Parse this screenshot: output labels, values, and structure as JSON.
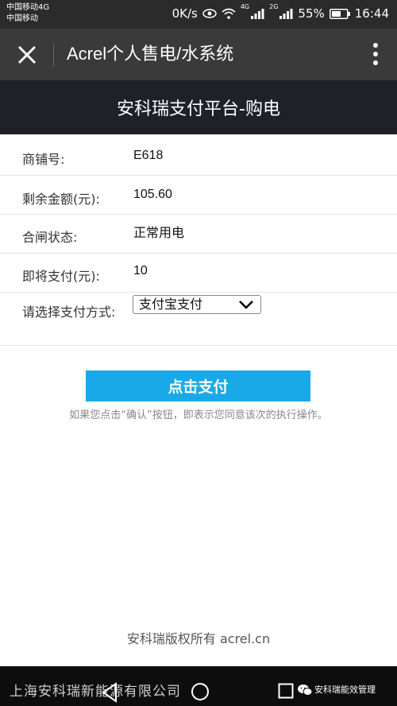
{
  "status_bar": {
    "carrier_line_1": "中国移动4G",
    "carrier_line_2": "中国移动",
    "net_speed": "0K/s",
    "signal_label_1": "4G",
    "signal_label_2": "2G",
    "battery": "55%",
    "time": "16:44"
  },
  "app_bar": {
    "title": "Acrel个人售电/水系统"
  },
  "page": {
    "title": "安科瑞支付平台-购电"
  },
  "form": {
    "rows": [
      {
        "label": "商铺号:",
        "value": "E618"
      },
      {
        "label": "剩余金额(元):",
        "value": "105.60"
      },
      {
        "label": "合闸状态:",
        "value": "正常用电"
      },
      {
        "label": "即将支付(元):",
        "value": "10"
      },
      {
        "label": "请选择支付方式:",
        "value": "支付宝支付"
      }
    ]
  },
  "actions": {
    "pay_label": "点击支付",
    "notice": "如果您点击“确认”按钮，即表示您同意该次的执行操作。"
  },
  "footer": {
    "copyright": "安科瑞版权所有 acrel.cn"
  },
  "watermark": {
    "company": "上海安科瑞新能源有限公司",
    "account": "安科瑞能效管理"
  },
  "colors": {
    "pay_button": "#19a9e8",
    "app_bar": "#3a3a3a",
    "page_bar": "#1e2228"
  },
  "icons": [
    "eye-icon",
    "wifi-icon",
    "signal-icon",
    "battery-icon",
    "close-icon",
    "more-icon",
    "chevron-down-icon",
    "back-icon",
    "home-icon",
    "recent-apps-icon",
    "wechat-icon"
  ]
}
